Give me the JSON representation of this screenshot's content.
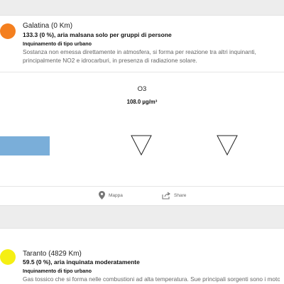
{
  "entries": [
    {
      "color": "#f47f1f",
      "title": "Galatina (0 Km)",
      "subtitle": "133.3 (0 %), aria malsana solo per gruppi di persone",
      "category": "Inquinamento di tipo urbano",
      "description_lines": [
        "Sostanza non emessa direttamente in atmosfera, si forma per reazione tra altri inquinanti,",
        "principalmente NO2 e idrocarburi, in presenza di radiazione solare."
      ],
      "pollutant": "O3",
      "value": "108.0 µg/m³",
      "bar_level_percent": 17,
      "actions": {
        "map_label": "Mappa",
        "map_icon": "map-pin-icon",
        "share_label": "Share",
        "share_icon": "share-icon"
      }
    },
    {
      "color": "#f5ef13",
      "title": "Taranto (4829 Km)",
      "subtitle": "59.5 (0 %), aria inquinata moderatamente",
      "category": "Inquinamento di tipo urbano",
      "description_lines": [
        "Gas tossico che si forma nelle combustioni ad alta temperatura. Sue principali sorgenti sono i motori"
      ]
    }
  ],
  "colors": {
    "bar": "#7aaed9",
    "icon": "#777777"
  }
}
